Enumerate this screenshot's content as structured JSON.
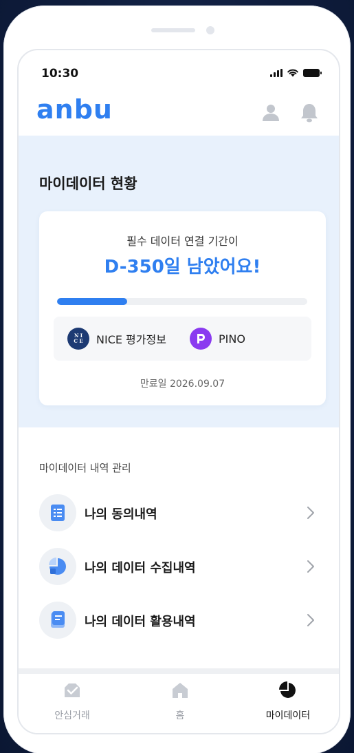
{
  "status_bar": {
    "time": "10:30"
  },
  "header": {
    "logo": "anbu"
  },
  "mydata_status": {
    "title": "마이데이터 현황",
    "subtitle": "필수 데이터 연결 기간이",
    "headline": "D-350일 남았어요!",
    "progress_fraction": 0.28,
    "partners": [
      {
        "name": "NICE 평가정보",
        "badge": "N I C E"
      },
      {
        "name": "PINO"
      }
    ],
    "expiry": "만료일 2026.09.07"
  },
  "management": {
    "title": "마이데이터 내역 관리",
    "items": [
      {
        "label": "나의 동의내역",
        "icon": "document-list-icon"
      },
      {
        "label": "나의 데이터 수집내역",
        "icon": "pie-chart-icon"
      },
      {
        "label": "나의 데이터 활용내역",
        "icon": "document-icon"
      }
    ]
  },
  "tabbar": {
    "tabs": [
      {
        "label": "안심거래",
        "icon": "check-shield-icon",
        "active": false
      },
      {
        "label": "홈",
        "icon": "home-icon",
        "active": false
      },
      {
        "label": "마이데이터",
        "icon": "pie-chart-icon",
        "active": true
      }
    ]
  },
  "colors": {
    "accent": "#2f7ff0",
    "section_bg": "#e8f1fc",
    "pino": "#8a3af0",
    "nice": "#1d3a73"
  }
}
